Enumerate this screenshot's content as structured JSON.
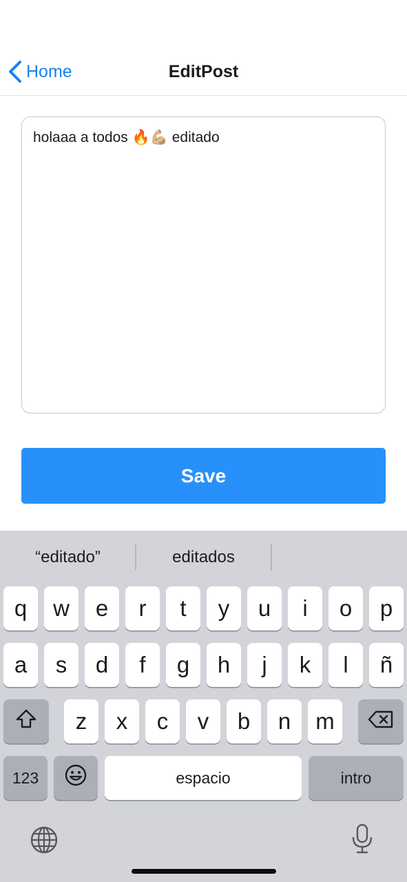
{
  "nav": {
    "back_label": "Home",
    "title": "EditPost"
  },
  "editor": {
    "value": "holaaa a todos 🔥💪🏼 editado"
  },
  "save_label": "Save",
  "keyboard": {
    "suggestions": [
      "“editado”",
      "editados"
    ],
    "row1": [
      "q",
      "w",
      "e",
      "r",
      "t",
      "y",
      "u",
      "i",
      "o",
      "p"
    ],
    "row2": [
      "a",
      "s",
      "d",
      "f",
      "g",
      "h",
      "j",
      "k",
      "l",
      "ñ"
    ],
    "row3": [
      "z",
      "x",
      "c",
      "v",
      "b",
      "n",
      "m"
    ],
    "numbers_label": "123",
    "space_label": "espacio",
    "return_label": "intro"
  },
  "colors": {
    "accent": "#1a82f0",
    "save_bg": "#2890fa",
    "keyboard_bg": "#d2d4da"
  }
}
